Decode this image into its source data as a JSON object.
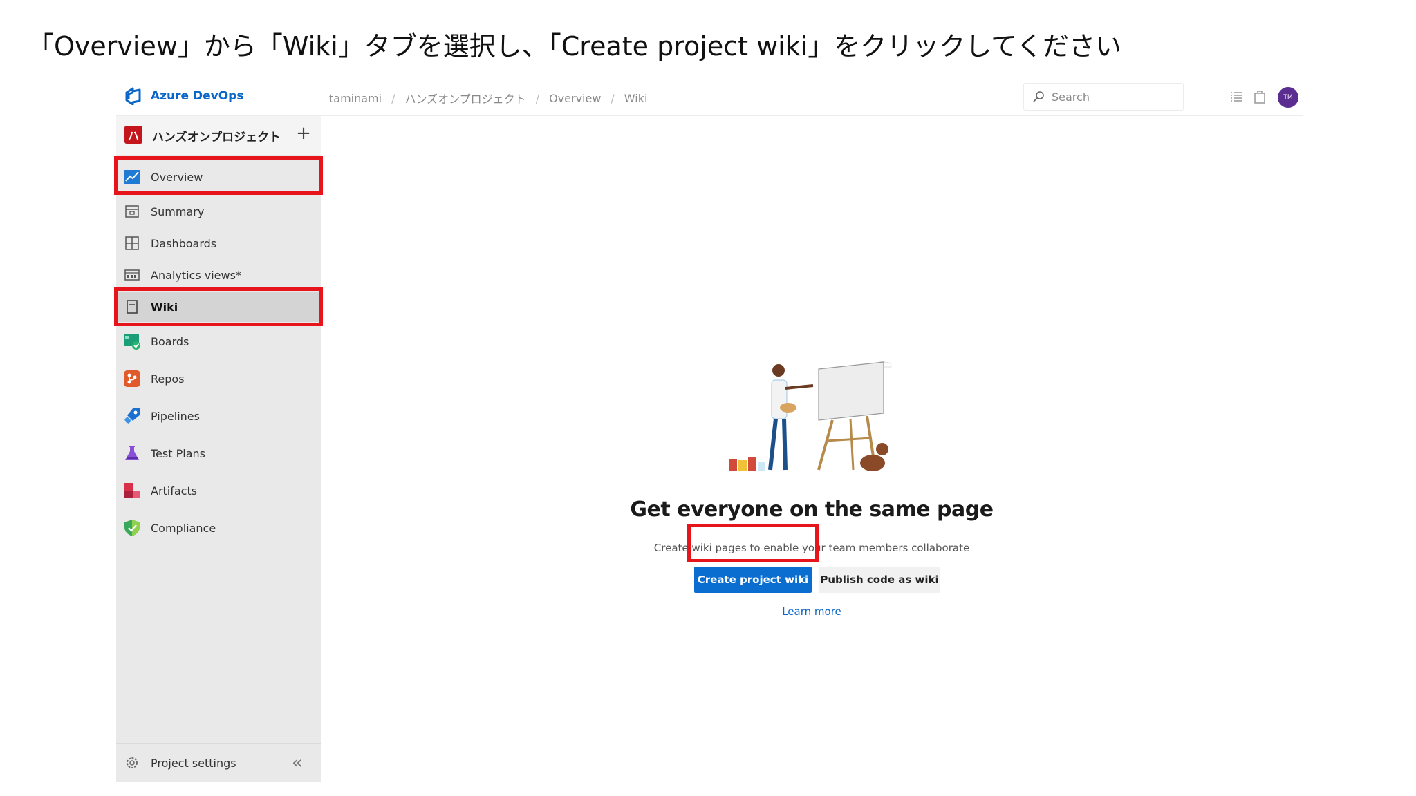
{
  "instruction": "「Overview」から「Wiki」タブを選択し、「Create project wiki」をクリックしてください",
  "header": {
    "brand": "Azure DevOps",
    "breadcrumb": [
      "taminami",
      "ハンズオンプロジェクト",
      "Overview",
      "Wiki"
    ],
    "breadcrumb_separator": "/",
    "search_placeholder": "Search",
    "avatar_initials": "TM",
    "avatar_color": "#5c2d91"
  },
  "sidebar": {
    "project_badge": "ハ",
    "project_name": "ハンズオンプロジェクト",
    "project_add": "+",
    "items": [
      {
        "label": "Overview",
        "icon": "overview-icon"
      },
      {
        "label": "Summary",
        "icon": "summary-icon"
      },
      {
        "label": "Dashboards",
        "icon": "dashboards-icon"
      },
      {
        "label": "Analytics views*",
        "icon": "analytics-icon"
      },
      {
        "label": "Wiki",
        "icon": "wiki-icon"
      },
      {
        "label": "Boards",
        "icon": "boards-icon"
      },
      {
        "label": "Repos",
        "icon": "repos-icon"
      },
      {
        "label": "Pipelines",
        "icon": "pipelines-icon"
      },
      {
        "label": "Test Plans",
        "icon": "test-plans-icon"
      },
      {
        "label": "Artifacts",
        "icon": "artifacts-icon"
      },
      {
        "label": "Compliance",
        "icon": "compliance-icon"
      }
    ],
    "selected": "Wiki",
    "settings_label": "Project settings",
    "collapse_glyph": "«"
  },
  "main": {
    "headline": "Get everyone on the same page",
    "subtext": "Create wiki pages to enable your team members collaborate",
    "primary_button": "Create project wiki",
    "secondary_button": "Publish code as wiki",
    "learn_more": "Learn more"
  },
  "colors": {
    "accent": "#0a6ed1",
    "highlight": "#e8141c",
    "project_badge": "#c4151c"
  }
}
